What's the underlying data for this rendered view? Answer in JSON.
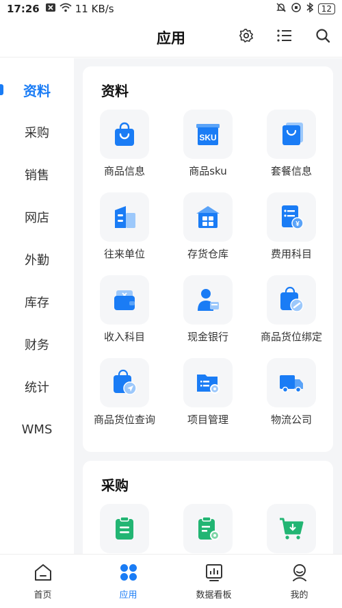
{
  "status_bar": {
    "time": "17:26",
    "speed": "11 KB/s",
    "battery": "12"
  },
  "header": {
    "title": "应用"
  },
  "sidebar": {
    "items": [
      {
        "label": "资料",
        "active": true
      },
      {
        "label": "采购"
      },
      {
        "label": "销售"
      },
      {
        "label": "网店"
      },
      {
        "label": "外勤"
      },
      {
        "label": "库存"
      },
      {
        "label": "财务"
      },
      {
        "label": "统计"
      },
      {
        "label": "WMS"
      }
    ]
  },
  "sections": [
    {
      "title": "资料",
      "items": [
        {
          "label": "商品信息",
          "icon": "shopping-bag-icon"
        },
        {
          "label": "商品sku",
          "icon": "sku-box-icon"
        },
        {
          "label": "套餐信息",
          "icon": "bundle-icon"
        },
        {
          "label": "往来单位",
          "icon": "building-icon"
        },
        {
          "label": "存货仓库",
          "icon": "warehouse-icon"
        },
        {
          "label": "费用科目",
          "icon": "expense-doc-icon"
        },
        {
          "label": "收入科目",
          "icon": "wallet-icon"
        },
        {
          "label": "现金银行",
          "icon": "cashier-icon"
        },
        {
          "label": "商品货位绑定",
          "icon": "bag-link-icon"
        },
        {
          "label": "商品货位查询",
          "icon": "bag-search-icon"
        },
        {
          "label": "项目管理",
          "icon": "folder-gear-icon"
        },
        {
          "label": "物流公司",
          "icon": "truck-icon"
        }
      ]
    },
    {
      "title": "采购",
      "items": [
        {
          "label": "",
          "icon": "clipboard-icon"
        },
        {
          "label": "",
          "icon": "clipboard-gear-icon"
        },
        {
          "label": "",
          "icon": "cart-download-icon"
        }
      ]
    }
  ],
  "tabbar": {
    "items": [
      {
        "label": "首页",
        "icon": "home-icon"
      },
      {
        "label": "应用",
        "icon": "apps-icon",
        "active": true
      },
      {
        "label": "数据看板",
        "icon": "dashboard-icon"
      },
      {
        "label": "我的",
        "icon": "profile-icon"
      }
    ]
  },
  "colors": {
    "accent": "#1a7cf5",
    "green": "#22b573",
    "tile_bg": "#f5f6f8"
  }
}
